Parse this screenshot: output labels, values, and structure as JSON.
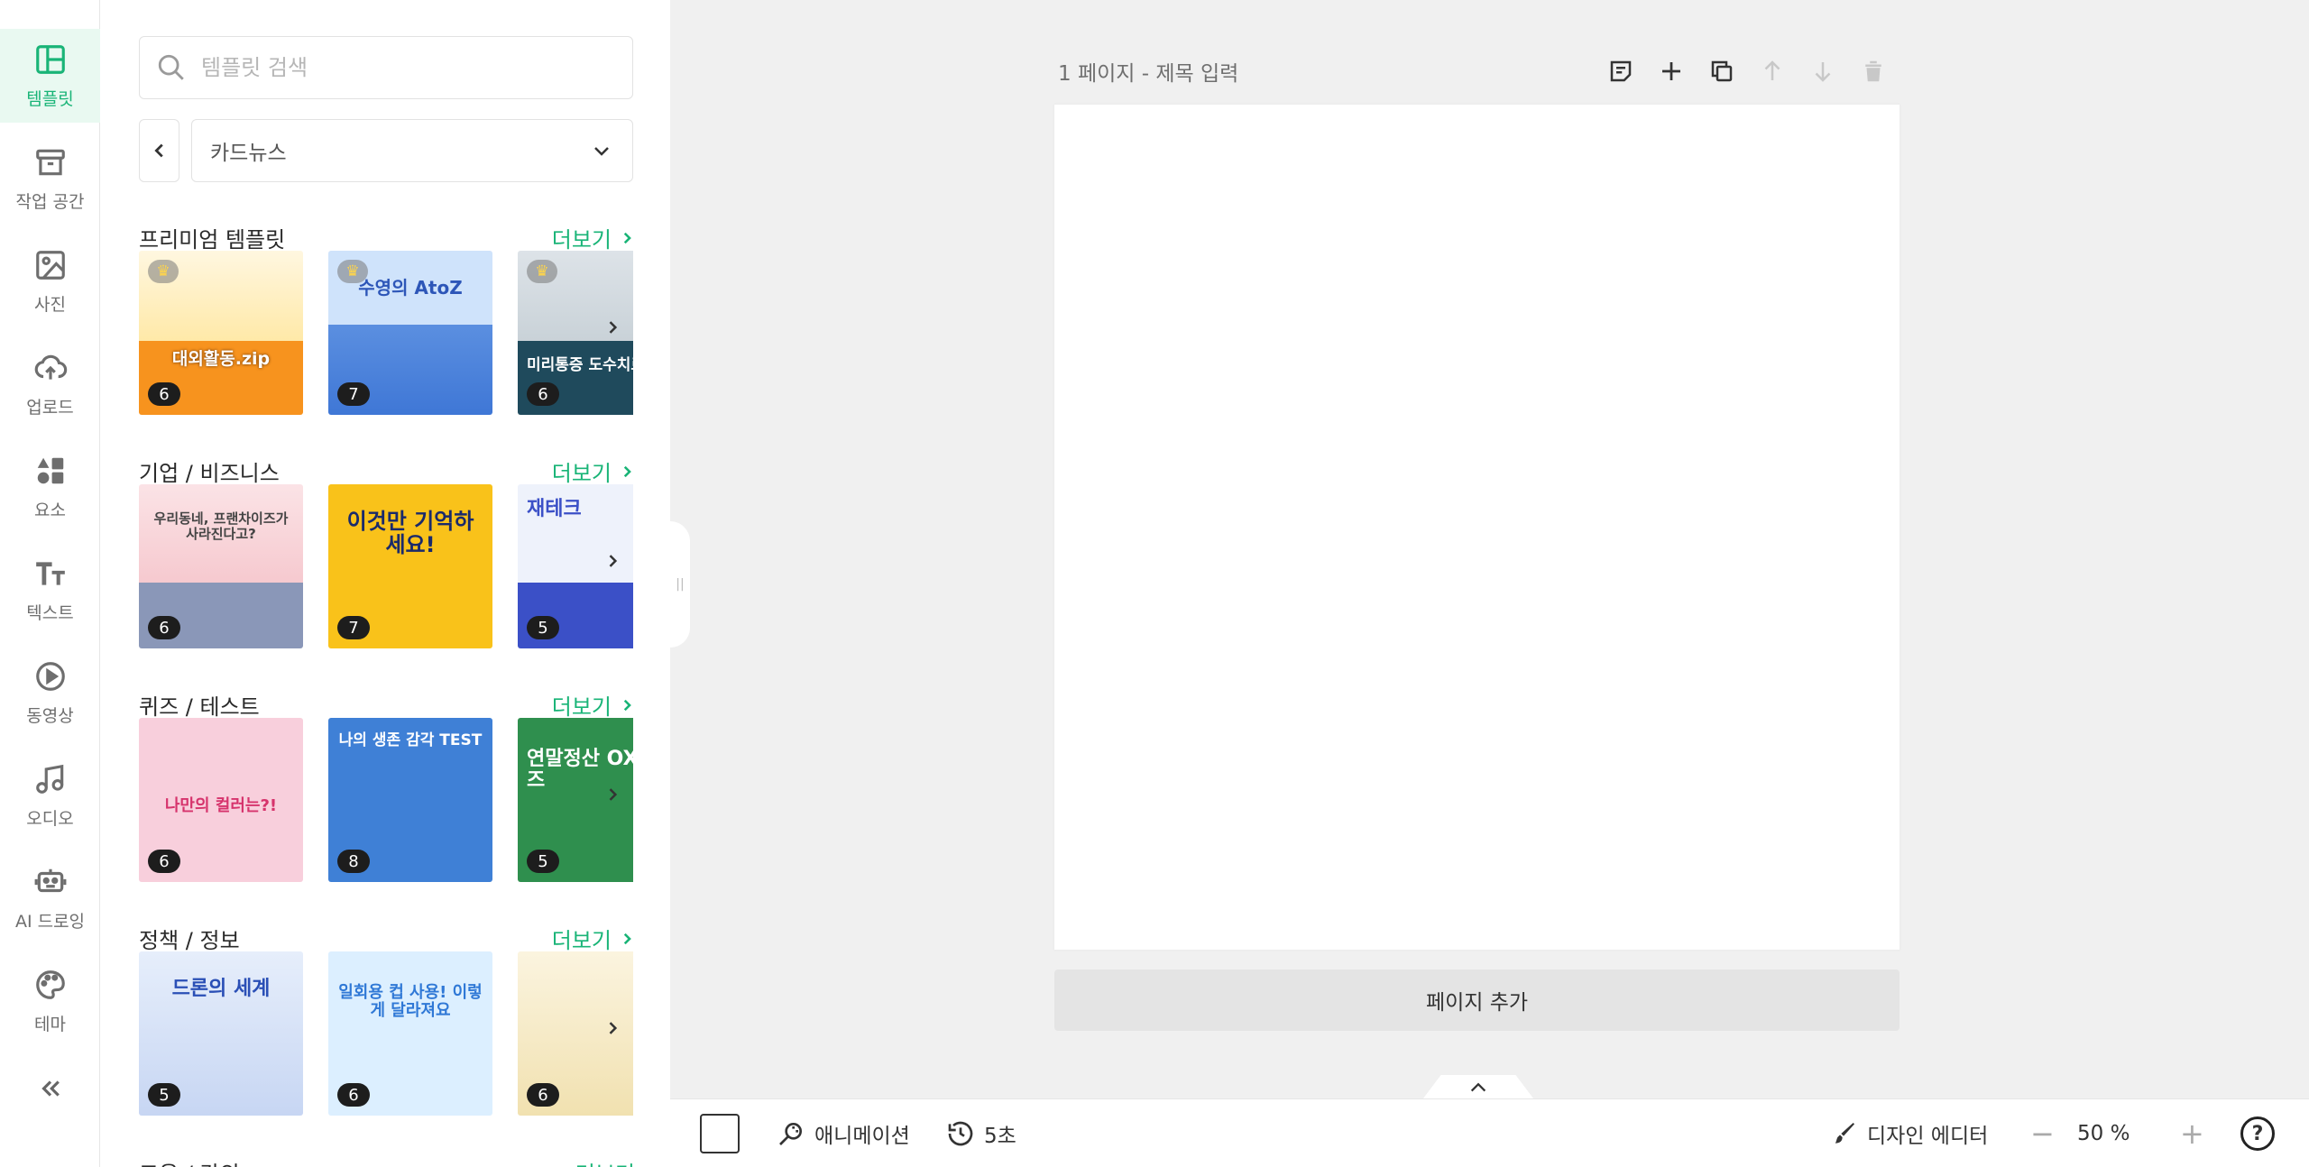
{
  "rail": {
    "items": [
      {
        "label": "템플릿",
        "icon": "layout-icon",
        "active": true
      },
      {
        "label": "작업 공간",
        "icon": "archive-box-icon"
      },
      {
        "label": "사진",
        "icon": "image-icon"
      },
      {
        "label": "업로드",
        "icon": "cloud-upload-icon"
      },
      {
        "label": "요소",
        "icon": "shapes-icon"
      },
      {
        "label": "텍스트",
        "icon": "text-size-icon"
      },
      {
        "label": "동영상",
        "icon": "play-circle-icon"
      },
      {
        "label": "오디오",
        "icon": "music-note-icon"
      },
      {
        "label": "AI 드로잉",
        "icon": "robot-icon"
      },
      {
        "label": "테마",
        "icon": "palette-icon"
      }
    ]
  },
  "panel": {
    "search_placeholder": "템플릿 검색",
    "category": "카드뉴스",
    "more_label": "더보기",
    "sections": [
      {
        "title": "프리미엄 템플릿",
        "thumbs": [
          {
            "count": "6",
            "text": "대외활동.zip",
            "premium": true
          },
          {
            "count": "7",
            "text": "수영의 AtoZ",
            "premium": true
          },
          {
            "count": "6",
            "text": "미리통증 도수치료",
            "premium": true
          }
        ]
      },
      {
        "title": "기업 / 비즈니스",
        "thumbs": [
          {
            "count": "6",
            "text": "우리동네, 프랜차이즈가 사라진다고?"
          },
          {
            "count": "7",
            "text": "이것만 기억하세요!"
          },
          {
            "count": "5",
            "text": "재테크"
          }
        ]
      },
      {
        "title": "퀴즈 / 테스트",
        "thumbs": [
          {
            "count": "6",
            "text": "나만의 컬러는?!"
          },
          {
            "count": "8",
            "text": "나의 생존 감각 TEST"
          },
          {
            "count": "5",
            "text": "연말정산 OX 퀴즈"
          }
        ]
      },
      {
        "title": "정책 / 정보",
        "thumbs": [
          {
            "count": "5",
            "text": "드론의 세계"
          },
          {
            "count": "6",
            "text": "일회용 컵 사용! 이렇게 달라져요"
          },
          {
            "count": "6",
            "text": ""
          }
        ]
      },
      {
        "title": "교육 / 강의",
        "thumbs": []
      }
    ]
  },
  "canvas": {
    "page_label": "1 페이지 - 제목 입력",
    "add_page": "페이지 추가"
  },
  "bottombar": {
    "animation": "애니메이션",
    "duration": "5초",
    "design_editor": "디자인 에디터",
    "zoom": "50 %",
    "help": "?"
  },
  "colors": {
    "accent": "#19b477"
  }
}
